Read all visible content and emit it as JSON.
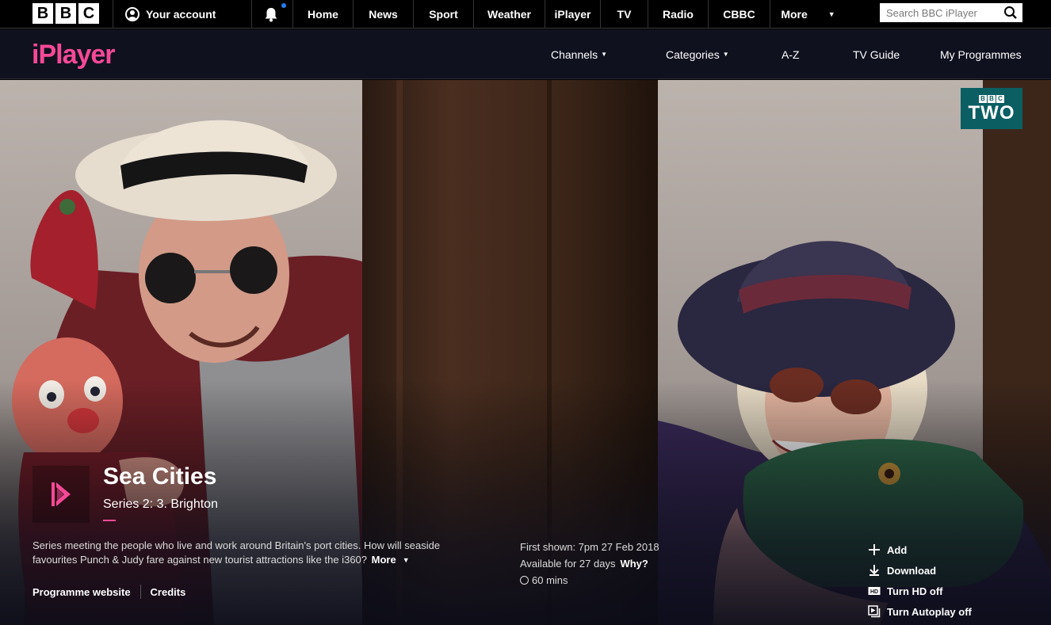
{
  "bbc_bar": {
    "logo_letters": [
      "B",
      "B",
      "C"
    ],
    "account_label": "Your account",
    "nav": [
      {
        "label": "Home",
        "width": 76
      },
      {
        "label": "News",
        "width": 76
      },
      {
        "label": "Sport",
        "width": 76
      },
      {
        "label": "Weather",
        "width": 90
      },
      {
        "label": "iPlayer",
        "width": 70
      },
      {
        "label": "TV",
        "width": 60
      },
      {
        "label": "Radio",
        "width": 76
      },
      {
        "label": "CBBC",
        "width": 78
      },
      {
        "label": "More",
        "width": 96
      }
    ],
    "search_placeholder": "Search BBC iPlayer",
    "notification_dot_color": "#1f7ef0"
  },
  "iplayer_bar": {
    "logo": "iPlayer",
    "logo_color": "#f54997",
    "nav": {
      "channels": "Channels",
      "categories": "Categories",
      "az": "A-Z",
      "tv_guide": "TV Guide",
      "my_programmes": "My Programmes"
    }
  },
  "channel": {
    "mini_logo": [
      "B",
      "B",
      "C"
    ],
    "name": "TWO",
    "color": "#0b5f63"
  },
  "programme": {
    "title": "Sea Cities",
    "subtitle": "Series 2: 3. Brighton",
    "synopsis": "Series meeting the people who live and work around Britain's port cities. How will seaside favourites Punch & Judy fare against new tourist attractions like the i360?",
    "more_label": "More",
    "links": {
      "website": "Programme website",
      "credits": "Credits"
    },
    "first_shown": "First shown: 7pm 27 Feb 2018",
    "availability": "Available for 27 days",
    "why_label": "Why?",
    "duration": "60 mins"
  },
  "actions": {
    "add": "Add",
    "download": "Download",
    "hd": "Turn HD off",
    "autoplay": "Turn Autoplay off"
  }
}
